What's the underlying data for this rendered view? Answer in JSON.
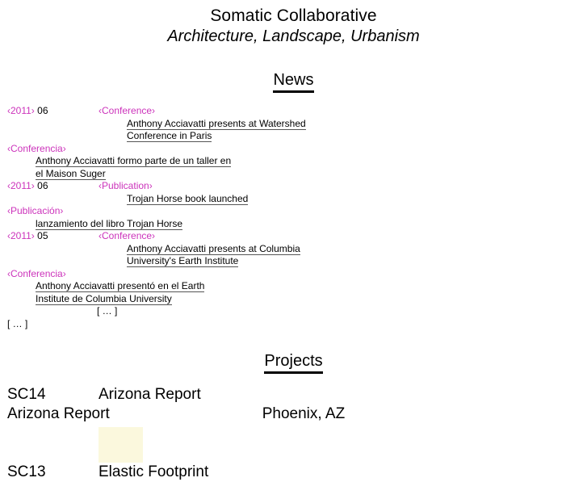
{
  "site": {
    "title": "Somatic Collaborative",
    "subtitle": "Architecture, Landscape, Urbanism"
  },
  "sections": {
    "news_heading": "News",
    "projects_heading": "Projects"
  },
  "news": {
    "items": [
      {
        "year": "‹2011›",
        "month": "06",
        "category_en": "‹Conference›",
        "title_en_line1": "Anthony Acciavatti presents at Watershed",
        "title_en_line2": "Conference in Paris",
        "category_es": "‹Conferencia›",
        "title_es_line1": "Anthony Acciavatti formo parte de un taller en",
        "title_es_line2": "el Maison Suger"
      },
      {
        "year": "‹2011›",
        "month": "06",
        "category_en": "‹Publication›",
        "title_en_line1": "Trojan Horse book launched",
        "title_en_line2": "",
        "category_es": "‹Publicación›",
        "title_es_line1": "lanzamiento del libro Trojan Horse",
        "title_es_line2": ""
      },
      {
        "year": "‹2011›",
        "month": "05",
        "category_en": "‹Conference›",
        "title_en_line1": "Anthony Acciavatti presents at Columbia",
        "title_en_line2": "University's Earth Institute",
        "category_es": "‹Conferencia›",
        "title_es_line1": "Anthony Acciavatti presentó en el Earth",
        "title_es_line2": "Institute de Columbia University"
      }
    ],
    "more_indented": "[ … ]",
    "more_left": "[ … ]"
  },
  "projects": {
    "items": [
      {
        "code": "SC14",
        "name": "Arizona Report",
        "subtitle": "Arizona Report",
        "location": "Phoenix, AZ",
        "thumbnail_alt": "arizona-report-cover"
      },
      {
        "code": "SC13",
        "name": "Elastic Footprint",
        "subtitle": "",
        "location": "",
        "thumbnail_alt": ""
      }
    ]
  },
  "colors": {
    "tag": "#cc33bb",
    "text": "#000000",
    "background": "#ffffff",
    "thumbnail": "#fbf8dd"
  }
}
